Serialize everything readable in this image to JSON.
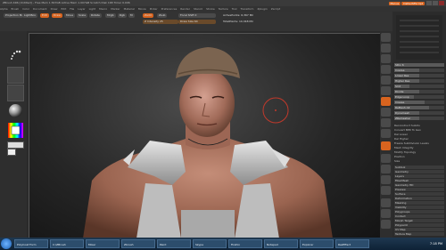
{
  "window": {
    "title": "ZBrush 4R6 [Untitled]  –  Free Mem 1.567GB  Active Mem 1.007GB  Scratch Disk 168  Timer 0.006",
    "menu_button": "Menus",
    "script_button": "DefaultZScript"
  },
  "menu": [
    "Alpha",
    "Brush",
    "Color",
    "Document",
    "Draw",
    "Edit",
    "File",
    "Layer",
    "Light",
    "Macro",
    "Marker",
    "Material",
    "Movie",
    "Picker",
    "Preferences",
    "Render",
    "Stencil",
    "Stroke",
    "Texture",
    "Tool",
    "Transform",
    "Zplugin",
    "Zscript"
  ],
  "toolbar": {
    "projection": "Projection Master",
    "lightbox": "LightBox",
    "mrgb": "Mrgb",
    "rgb": "Rgb",
    "m": "M",
    "zadd": "Zadd",
    "zsub": "Zsub",
    "focal_shift": "Focal Shift 0",
    "draw_size": "Draw Size 64",
    "z_intensity": "Z Intensity 25",
    "active_points": "ActivePoints: 6,367 Mil",
    "total_points": "TotalPoints: 10,348 Mil",
    "edit": "Edit",
    "draw": "Draw",
    "move": "Move",
    "scale": "Scale",
    "rotate": "Rotate"
  },
  "left_shelf": {
    "standard": "Standard",
    "dots": "Dots",
    "alpha_off": "Alpha Off",
    "texture_off": "Texture Off",
    "material": "MatCap Red Wax",
    "gradient": "Gradient",
    "switch_color": "SwitchColor"
  },
  "tray": {
    "sections": [
      "Subtool",
      "Geometry",
      "Layers",
      "FiberMesh",
      "Geometry HD",
      "Preview",
      "Surface",
      "Deformation",
      "Masking",
      "Visibility",
      "Polygroups",
      "Contact",
      "Morph Target",
      "Polypaint",
      "UV Map",
      "Texture Map"
    ],
    "sliders": [
      {
        "label": "SDiv 6",
        "fill": 1.0
      },
      {
        "label": "Coarse",
        "fill": 0.5
      },
      {
        "label": "Lower Res",
        "fill": 0.5
      },
      {
        "label": "Higher Res",
        "fill": 0.5
      },
      {
        "label": "Smt",
        "fill": 0.3
      },
      {
        "label": "Divide",
        "fill": 0.5
      },
      {
        "label": "Edge Loop",
        "fill": 0.4
      },
      {
        "label": "Crease",
        "fill": 0.6
      },
      {
        "label": "ReMesh All",
        "fill": 0.7
      },
      {
        "label": "Dynamesh",
        "fill": 0.5
      },
      {
        "label": "ZRemesher",
        "fill": 0.5
      }
    ],
    "items": [
      "Reconstruct Subdiv",
      "Convert BPR To Geo",
      "Del Lower",
      "Del Higher",
      "Freeze SubDivision Levels",
      "Mesh Integrity",
      "Modify Topology",
      "Position",
      "Size"
    ]
  },
  "taskbar": {
    "items": [
      "PolyCoat Form",
      "C:\\ZBrush",
      "Mixer",
      "Zbrush",
      "Paint",
      "Skype",
      "Firefox",
      "Notepad",
      "Explorer",
      "RezEffect"
    ],
    "clock": "7:18 PM"
  },
  "colors": {
    "accent": "#d8641f",
    "skin": "#b27a63",
    "fur": "#7a6550",
    "cloth": "#c8c8c8"
  }
}
